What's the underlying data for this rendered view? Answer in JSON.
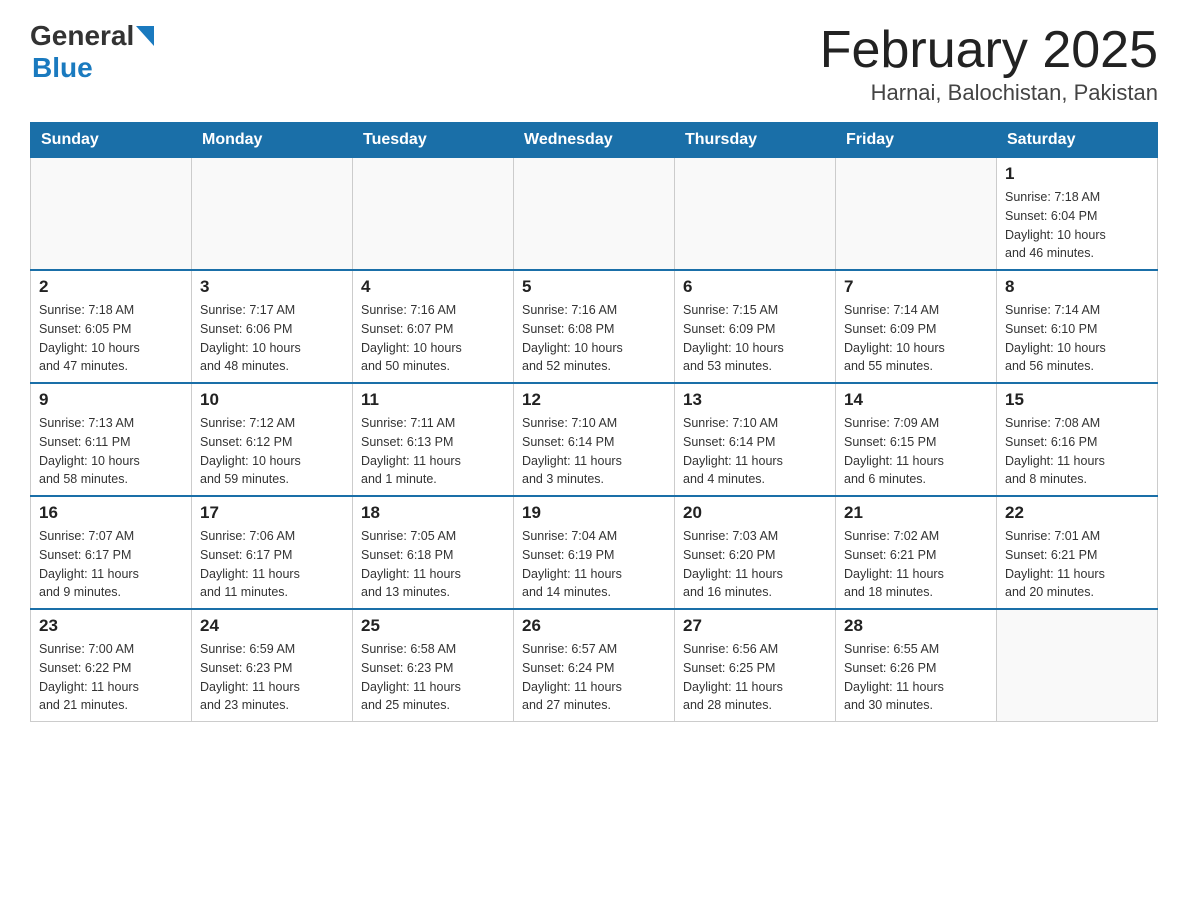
{
  "header": {
    "logo_general": "General",
    "logo_blue": "Blue",
    "title": "February 2025",
    "subtitle": "Harnai, Balochistan, Pakistan"
  },
  "days_of_week": [
    "Sunday",
    "Monday",
    "Tuesday",
    "Wednesday",
    "Thursday",
    "Friday",
    "Saturday"
  ],
  "weeks": [
    [
      {
        "day": "",
        "info": ""
      },
      {
        "day": "",
        "info": ""
      },
      {
        "day": "",
        "info": ""
      },
      {
        "day": "",
        "info": ""
      },
      {
        "day": "",
        "info": ""
      },
      {
        "day": "",
        "info": ""
      },
      {
        "day": "1",
        "info": "Sunrise: 7:18 AM\nSunset: 6:04 PM\nDaylight: 10 hours\nand 46 minutes."
      }
    ],
    [
      {
        "day": "2",
        "info": "Sunrise: 7:18 AM\nSunset: 6:05 PM\nDaylight: 10 hours\nand 47 minutes."
      },
      {
        "day": "3",
        "info": "Sunrise: 7:17 AM\nSunset: 6:06 PM\nDaylight: 10 hours\nand 48 minutes."
      },
      {
        "day": "4",
        "info": "Sunrise: 7:16 AM\nSunset: 6:07 PM\nDaylight: 10 hours\nand 50 minutes."
      },
      {
        "day": "5",
        "info": "Sunrise: 7:16 AM\nSunset: 6:08 PM\nDaylight: 10 hours\nand 52 minutes."
      },
      {
        "day": "6",
        "info": "Sunrise: 7:15 AM\nSunset: 6:09 PM\nDaylight: 10 hours\nand 53 minutes."
      },
      {
        "day": "7",
        "info": "Sunrise: 7:14 AM\nSunset: 6:09 PM\nDaylight: 10 hours\nand 55 minutes."
      },
      {
        "day": "8",
        "info": "Sunrise: 7:14 AM\nSunset: 6:10 PM\nDaylight: 10 hours\nand 56 minutes."
      }
    ],
    [
      {
        "day": "9",
        "info": "Sunrise: 7:13 AM\nSunset: 6:11 PM\nDaylight: 10 hours\nand 58 minutes."
      },
      {
        "day": "10",
        "info": "Sunrise: 7:12 AM\nSunset: 6:12 PM\nDaylight: 10 hours\nand 59 minutes."
      },
      {
        "day": "11",
        "info": "Sunrise: 7:11 AM\nSunset: 6:13 PM\nDaylight: 11 hours\nand 1 minute."
      },
      {
        "day": "12",
        "info": "Sunrise: 7:10 AM\nSunset: 6:14 PM\nDaylight: 11 hours\nand 3 minutes."
      },
      {
        "day": "13",
        "info": "Sunrise: 7:10 AM\nSunset: 6:14 PM\nDaylight: 11 hours\nand 4 minutes."
      },
      {
        "day": "14",
        "info": "Sunrise: 7:09 AM\nSunset: 6:15 PM\nDaylight: 11 hours\nand 6 minutes."
      },
      {
        "day": "15",
        "info": "Sunrise: 7:08 AM\nSunset: 6:16 PM\nDaylight: 11 hours\nand 8 minutes."
      }
    ],
    [
      {
        "day": "16",
        "info": "Sunrise: 7:07 AM\nSunset: 6:17 PM\nDaylight: 11 hours\nand 9 minutes."
      },
      {
        "day": "17",
        "info": "Sunrise: 7:06 AM\nSunset: 6:17 PM\nDaylight: 11 hours\nand 11 minutes."
      },
      {
        "day": "18",
        "info": "Sunrise: 7:05 AM\nSunset: 6:18 PM\nDaylight: 11 hours\nand 13 minutes."
      },
      {
        "day": "19",
        "info": "Sunrise: 7:04 AM\nSunset: 6:19 PM\nDaylight: 11 hours\nand 14 minutes."
      },
      {
        "day": "20",
        "info": "Sunrise: 7:03 AM\nSunset: 6:20 PM\nDaylight: 11 hours\nand 16 minutes."
      },
      {
        "day": "21",
        "info": "Sunrise: 7:02 AM\nSunset: 6:21 PM\nDaylight: 11 hours\nand 18 minutes."
      },
      {
        "day": "22",
        "info": "Sunrise: 7:01 AM\nSunset: 6:21 PM\nDaylight: 11 hours\nand 20 minutes."
      }
    ],
    [
      {
        "day": "23",
        "info": "Sunrise: 7:00 AM\nSunset: 6:22 PM\nDaylight: 11 hours\nand 21 minutes."
      },
      {
        "day": "24",
        "info": "Sunrise: 6:59 AM\nSunset: 6:23 PM\nDaylight: 11 hours\nand 23 minutes."
      },
      {
        "day": "25",
        "info": "Sunrise: 6:58 AM\nSunset: 6:23 PM\nDaylight: 11 hours\nand 25 minutes."
      },
      {
        "day": "26",
        "info": "Sunrise: 6:57 AM\nSunset: 6:24 PM\nDaylight: 11 hours\nand 27 minutes."
      },
      {
        "day": "27",
        "info": "Sunrise: 6:56 AM\nSunset: 6:25 PM\nDaylight: 11 hours\nand 28 minutes."
      },
      {
        "day": "28",
        "info": "Sunrise: 6:55 AM\nSunset: 6:26 PM\nDaylight: 11 hours\nand 30 minutes."
      },
      {
        "day": "",
        "info": ""
      }
    ]
  ]
}
